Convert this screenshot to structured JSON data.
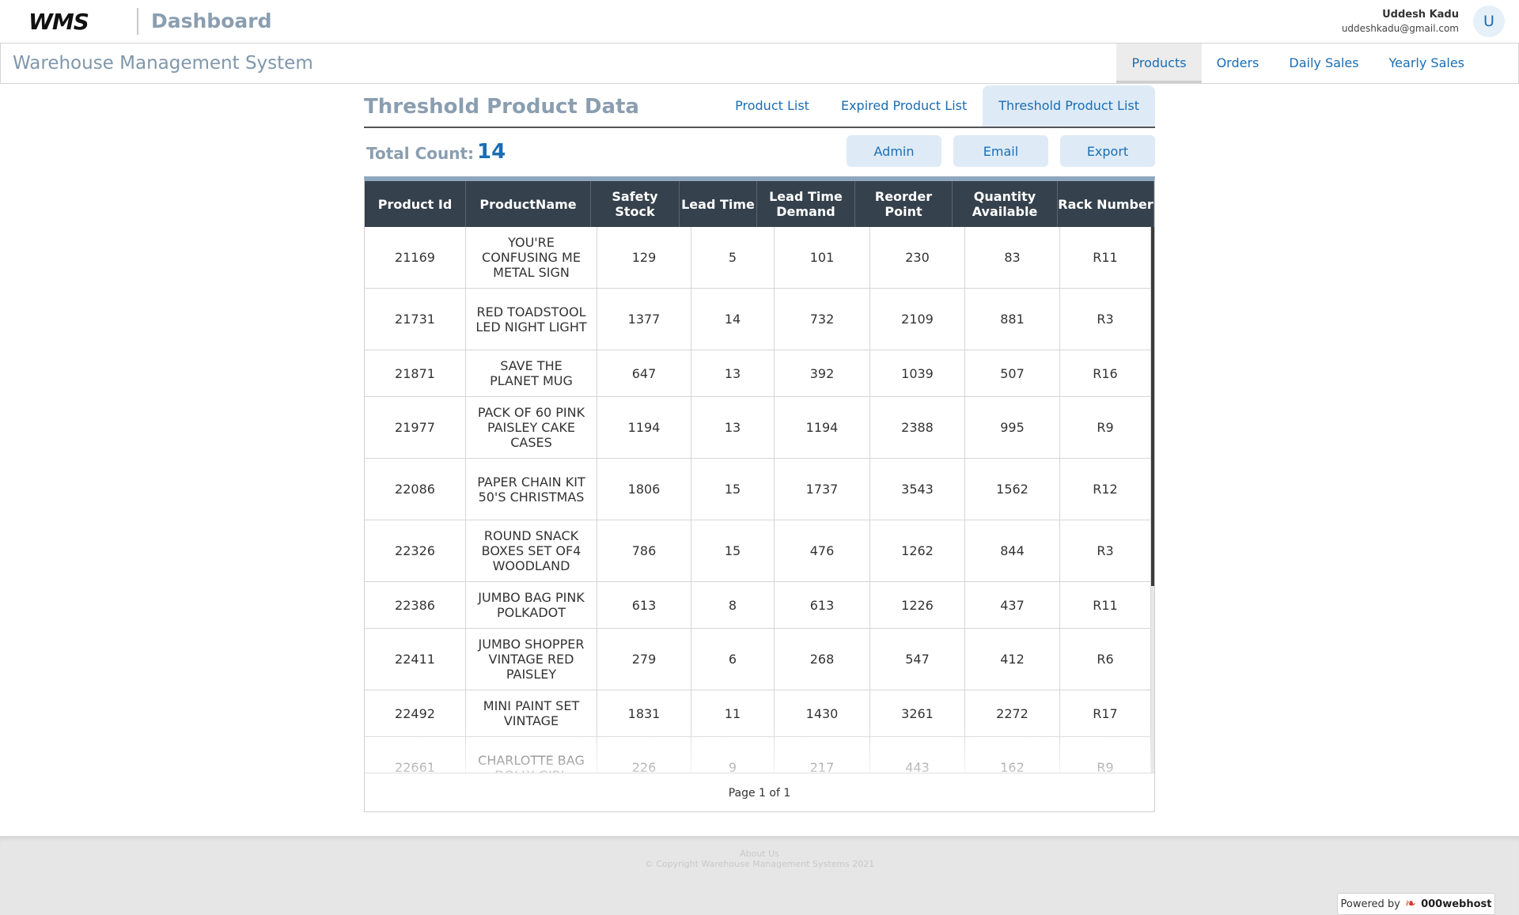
{
  "header": {
    "logo_text": "WMS",
    "dashboard_label": "Dashboard",
    "user_name": "Uddesh Kadu",
    "user_email": "uddeshkadu@gmail.com",
    "avatar_letter": "U"
  },
  "navbar": {
    "app_title": "Warehouse Management System",
    "tabs": [
      {
        "label": "Products",
        "active": true
      },
      {
        "label": "Orders",
        "active": false
      },
      {
        "label": "Daily Sales",
        "active": false
      },
      {
        "label": "Yearly Sales",
        "active": false
      }
    ]
  },
  "section": {
    "title": "Threshold Product Data",
    "tabs": [
      {
        "label": "Product List",
        "active": false
      },
      {
        "label": "Expired Product List",
        "active": false
      },
      {
        "label": "Threshold Product List",
        "active": true
      }
    ]
  },
  "summary": {
    "count_label": "Total Count:",
    "count_value": "14",
    "buttons": [
      "Admin",
      "Email",
      "Export"
    ]
  },
  "table": {
    "columns": [
      "Product Id",
      "ProductName",
      "Safety Stock",
      "Lead Time",
      "Lead Time Demand",
      "Reorder Point",
      "Quantity Available",
      "Rack Number"
    ],
    "rows": [
      [
        "21169",
        "YOU'RE CONFUSING ME METAL SIGN",
        "129",
        "5",
        "101",
        "230",
        "83",
        "R11"
      ],
      [
        "21731",
        "RED TOADSTOOL LED NIGHT LIGHT",
        "1377",
        "14",
        "732",
        "2109",
        "881",
        "R3"
      ],
      [
        "21871",
        "SAVE THE PLANET MUG",
        "647",
        "13",
        "392",
        "1039",
        "507",
        "R16"
      ],
      [
        "21977",
        "PACK OF 60 PINK PAISLEY CAKE CASES",
        "1194",
        "13",
        "1194",
        "2388",
        "995",
        "R9"
      ],
      [
        "22086",
        "PAPER CHAIN KIT 50'S CHRISTMAS",
        "1806",
        "15",
        "1737",
        "3543",
        "1562",
        "R12"
      ],
      [
        "22326",
        "ROUND SNACK BOXES SET OF4 WOODLAND",
        "786",
        "15",
        "476",
        "1262",
        "844",
        "R3"
      ],
      [
        "22386",
        "JUMBO BAG PINK POLKADOT",
        "613",
        "8",
        "613",
        "1226",
        "437",
        "R11"
      ],
      [
        "22411",
        "JUMBO SHOPPER VINTAGE RED PAISLEY",
        "279",
        "6",
        "268",
        "547",
        "412",
        "R6"
      ],
      [
        "22492",
        "MINI PAINT SET VINTAGE",
        "1831",
        "11",
        "1430",
        "3261",
        "2272",
        "R17"
      ],
      [
        "22661",
        "CHARLOTTE BAG DOLLY GIRL",
        "226",
        "9",
        "217",
        "443",
        "162",
        "R9"
      ]
    ],
    "pager": "Page 1 of 1"
  },
  "footer": {
    "about": "About Us",
    "copyright": "© Copyright Warehouse Management Systems 2021",
    "powered_by": "Powered by",
    "host_brand": "000webhost"
  }
}
